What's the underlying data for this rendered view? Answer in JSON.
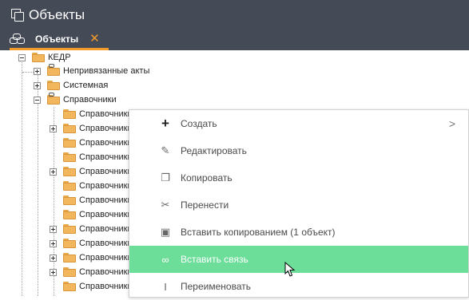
{
  "window": {
    "title": "Объекты"
  },
  "tabs": [
    {
      "label": "Объекты",
      "close": "✕"
    }
  ],
  "tree": {
    "root": "КЕДР",
    "level1": [
      "Непривязанные акты",
      "Системная",
      "Справочники"
    ],
    "child_label": "Справочники"
  },
  "menu": {
    "items": [
      {
        "label": "Создать",
        "icon": "plus-icon",
        "submenu_arrow": ">"
      },
      {
        "label": "Редактировать",
        "icon": "edit-icon"
      },
      {
        "label": "Копировать",
        "icon": "copy-icon"
      },
      {
        "label": "Перенести",
        "icon": "scissors-icon"
      },
      {
        "label": "Вставить копированием (1 объект)",
        "icon": "paste-icon"
      },
      {
        "label": "Вставить связь",
        "icon": "link-icon"
      },
      {
        "label": "Переименовать",
        "icon": "text-cursor-icon"
      }
    ]
  },
  "colors": {
    "header": "#454a57",
    "accent": "#f39a2b",
    "highlight": "#6cde9a"
  }
}
